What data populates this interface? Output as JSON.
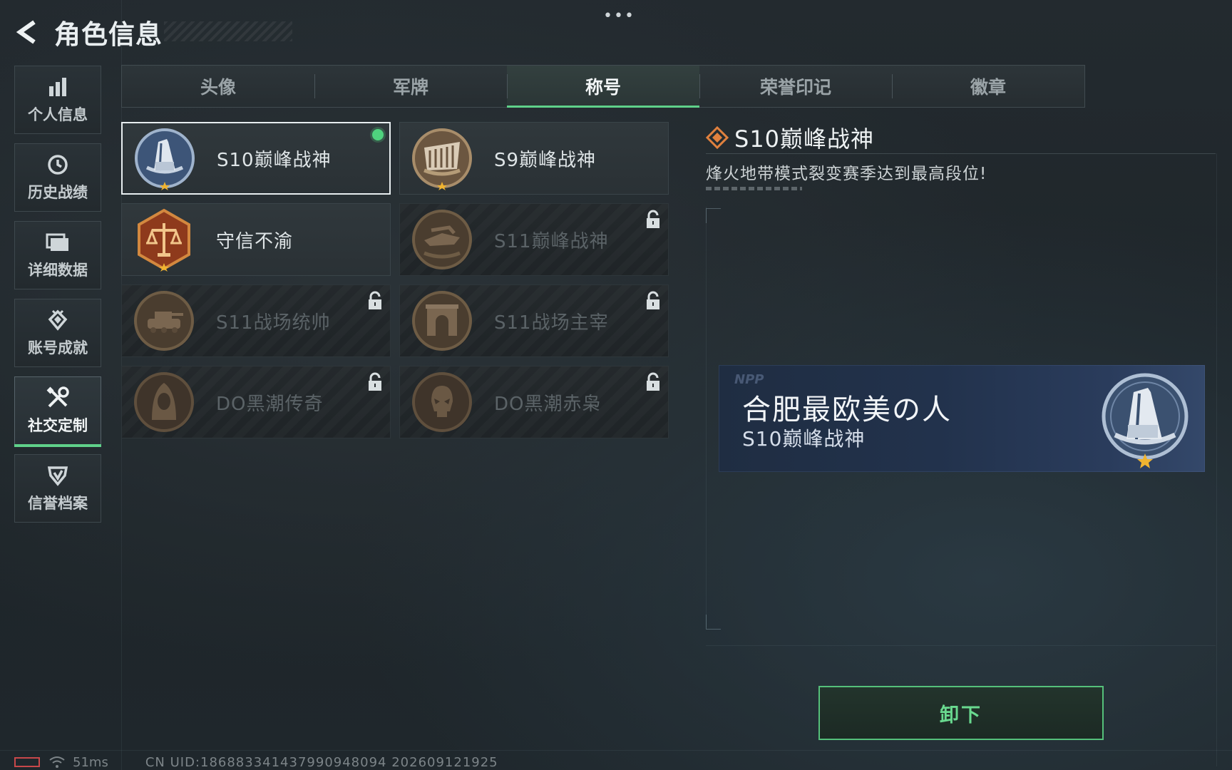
{
  "header": {
    "title": "角色信息",
    "more": "•••"
  },
  "sidebar": {
    "items": [
      {
        "label": "个人信息",
        "icon": "bar-chart-icon",
        "active": false
      },
      {
        "label": "历史战绩",
        "icon": "clock-icon",
        "active": false
      },
      {
        "label": "详细数据",
        "icon": "folder-icon",
        "active": false
      },
      {
        "label": "账号成就",
        "icon": "achievement-icon",
        "active": false
      },
      {
        "label": "社交定制",
        "icon": "tools-icon",
        "active": true
      },
      {
        "label": "信誉档案",
        "icon": "shield-check-icon",
        "active": false
      }
    ]
  },
  "tabs": [
    {
      "label": "头像",
      "active": false
    },
    {
      "label": "军牌",
      "active": false
    },
    {
      "label": "称号",
      "active": true
    },
    {
      "label": "荣誉印记",
      "active": false
    },
    {
      "label": "徽章",
      "active": false
    }
  ],
  "titles": [
    {
      "name": "S10巅峰战神",
      "state": "equipped",
      "emblem": "blue-tower-emblem"
    },
    {
      "name": "S9巅峰战神",
      "state": "owned",
      "emblem": "bronze-dam-emblem"
    },
    {
      "name": "守信不渝",
      "state": "owned",
      "emblem": "scales-emblem"
    },
    {
      "name": "S11巅峰战神",
      "state": "locked",
      "emblem": "bronze-aircraft-emblem"
    },
    {
      "name": "S11战场统帅",
      "state": "locked",
      "emblem": "bronze-tank-emblem"
    },
    {
      "name": "S11战场主宰",
      "state": "locked",
      "emblem": "bronze-arch-emblem"
    },
    {
      "name": "DO黑潮传奇",
      "state": "locked",
      "emblem": "bronze-hooded-emblem"
    },
    {
      "name": "DO黑潮赤枭",
      "state": "locked",
      "emblem": "bronze-skull-emblem"
    }
  ],
  "detail": {
    "name": "S10巅峰战神",
    "description": "烽火地带模式裂变赛季达到最高段位!"
  },
  "preview": {
    "brand": "NPP",
    "player_name": "合肥最欧美の人",
    "title": "S10巅峰战神"
  },
  "actions": {
    "unequip_label": "卸下"
  },
  "status": {
    "ping": "51ms",
    "uid": "CN UID:186883341437990948094 202609121925"
  },
  "colors": {
    "accent_green": "#5fd18a",
    "equipped_dot": "#4fd37e",
    "battery_red": "#c8484a",
    "detail_icon_orange": "#e0813e"
  }
}
